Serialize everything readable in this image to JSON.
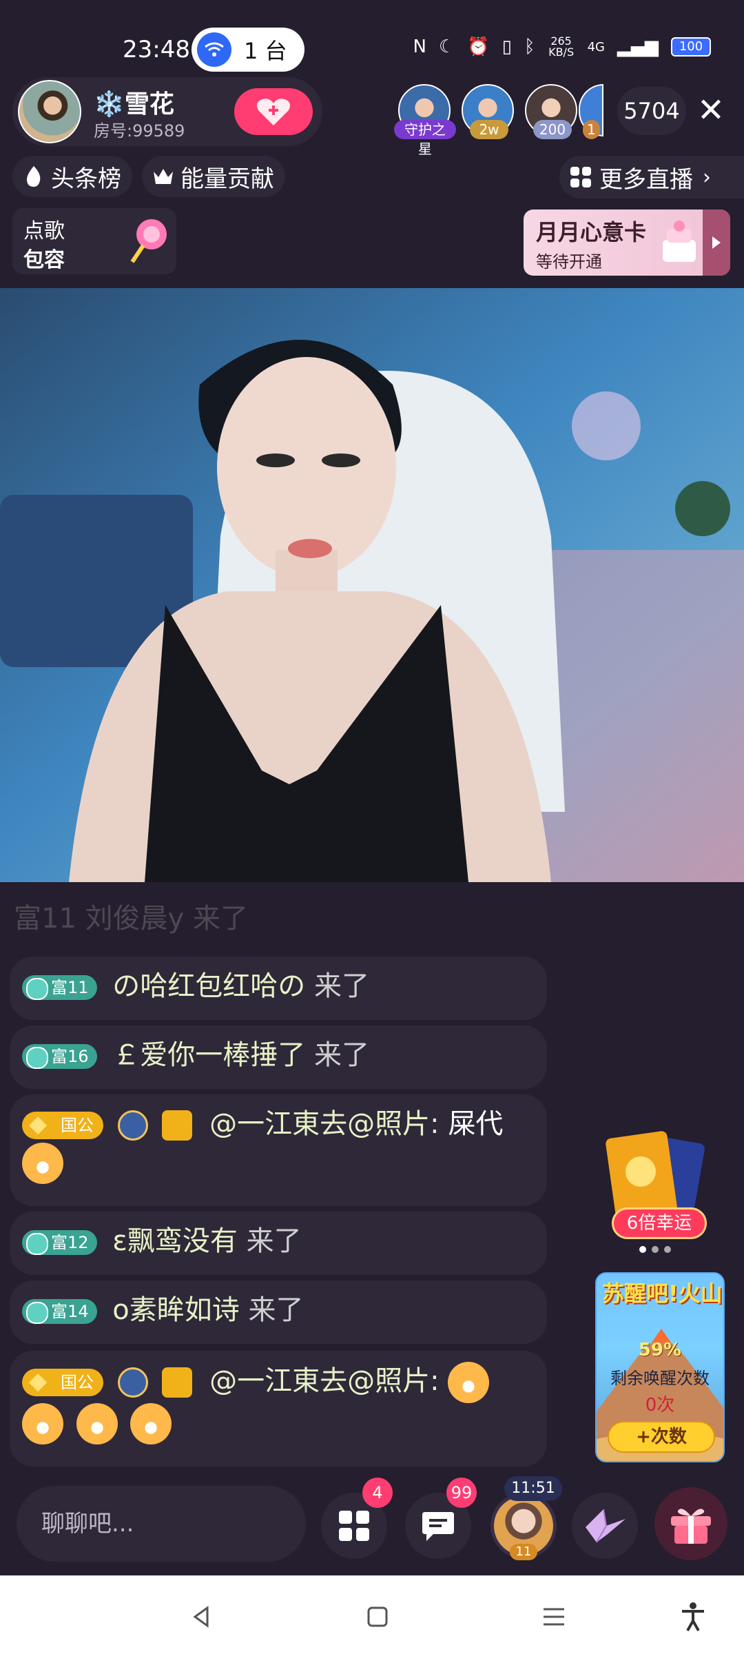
{
  "status_bar": {
    "time": "23:48",
    "pill_text": "1 台",
    "net_speed": "265 KB/S",
    "net_type": "4G",
    "battery": "100"
  },
  "host": {
    "name": "❄️雪花",
    "room": "房号:99589"
  },
  "viewers": {
    "avatar_badges": [
      "守护之星",
      "2w",
      "200",
      "1"
    ],
    "count": "5704"
  },
  "ranks": {
    "headline": "头条榜",
    "energy": "能量贡献",
    "more_live": "更多直播"
  },
  "song_card": {
    "title": "点歌",
    "subtitle": "包容"
  },
  "month_card": {
    "title": "月月心意卡",
    "subtitle": "等待开通"
  },
  "chat": {
    "faded": "富11  刘俊晨y 来了",
    "items": [
      {
        "level": "富11",
        "user": "の哈红包红哈の",
        "action": "来了"
      },
      {
        "level": "富16",
        "user": "￡爱你一棒捶了",
        "action": "来了"
      },
      {
        "guild": "国公",
        "user": "@一江東去@照片:",
        "message": "屎代"
      },
      {
        "level": "富12",
        "user": "ɛ飘鸾没有",
        "action": "来了"
      },
      {
        "level": "富14",
        "user": "ο素眸如诗",
        "action": "来了"
      },
      {
        "guild": "国公",
        "user": "@一江東去@照片:",
        "message": ""
      }
    ]
  },
  "lucky": {
    "label": "6倍幸运"
  },
  "volcano": {
    "title": "苏醒吧!火山",
    "percent": "59%",
    "desc": "剩余唤醒次数",
    "count": "0次",
    "button": "+次数"
  },
  "bottom_bar": {
    "input_placeholder": "聊聊吧...",
    "apps_badge": "4",
    "msg_badge": "99",
    "timer": "11:51",
    "avatar_level": "11"
  },
  "colors": {
    "background": "#241e2e",
    "card": "#2e2838",
    "accent_pink": "#ff3d72",
    "level_green": "#3aa392",
    "guild_gold": "#f1b219"
  }
}
